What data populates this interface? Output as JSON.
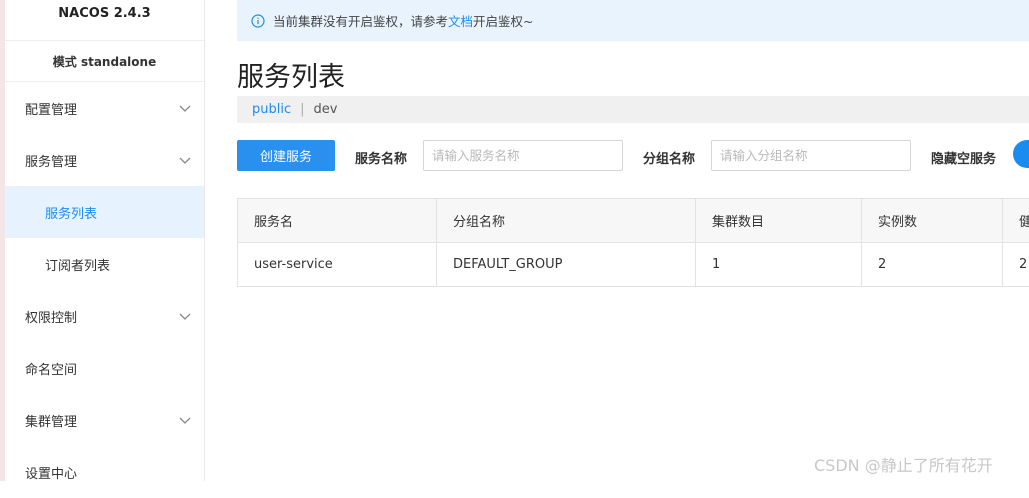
{
  "sidebar": {
    "brand": "NACOS 2.4.3",
    "mode": "模式 standalone",
    "items": [
      {
        "label": "配置管理"
      },
      {
        "label": "服务管理"
      },
      {
        "label": "服务列表"
      },
      {
        "label": "订阅者列表"
      },
      {
        "label": "权限控制"
      },
      {
        "label": "命名空间"
      },
      {
        "label": "集群管理"
      },
      {
        "label": "设置中心"
      }
    ]
  },
  "notice": {
    "before": "当前集群没有开启鉴权，请参考",
    "link": "文档",
    "after": "开启鉴权~"
  },
  "page": {
    "title": "服务列表"
  },
  "namespaces": {
    "public": "public",
    "separator": "|",
    "dev": "dev"
  },
  "toolbar": {
    "create_label": "创建服务",
    "service_name_label": "服务名称",
    "service_name_placeholder": "请输入服务名称",
    "group_name_label": "分组名称",
    "group_name_placeholder": "请输入分组名称",
    "hide_empty_label": "隐藏空服务"
  },
  "table": {
    "columns": [
      "服务名",
      "分组名称",
      "集群数目",
      "实例数",
      "健"
    ],
    "rows": [
      [
        "user-service",
        "DEFAULT_GROUP",
        "1",
        "2",
        "2"
      ]
    ]
  },
  "watermark": "CSDN @静止了所有花开",
  "colors": {
    "accent": "#1a8cf0",
    "notice_bg": "#e8f3fd",
    "active_bg": "#e6f2fd"
  }
}
